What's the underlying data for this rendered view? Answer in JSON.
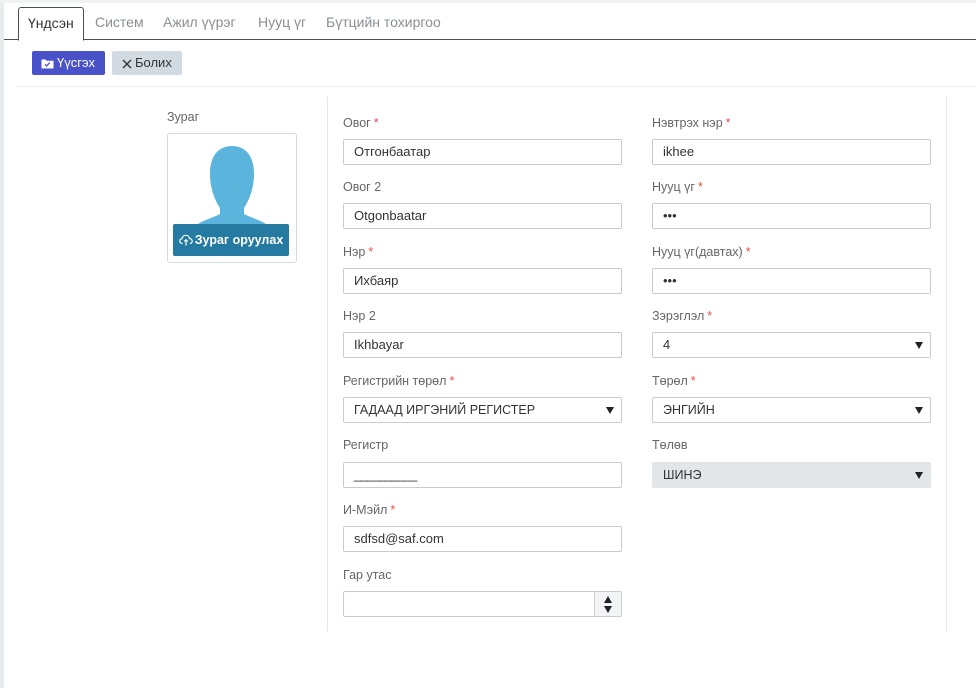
{
  "tabs": [
    {
      "label": "Үндсэн",
      "active": true
    },
    {
      "label": "Систем"
    },
    {
      "label": "Ажил үүрэг"
    },
    {
      "label": "Нууц үг"
    },
    {
      "label": "Бүтцийн тохиргоо"
    }
  ],
  "toolbar": {
    "save_label": "Үүсгэх",
    "save_icon": "folder-icon",
    "cancel_label": "Болих",
    "cancel_icon": "close-icon"
  },
  "photo": {
    "label": "Зураг",
    "upload_label": "Зураг оруулах",
    "upload_icon": "cloud-upload-icon"
  },
  "form": {
    "surname": {
      "label": "Овог",
      "required_mark": "*",
      "value": "Отгонбаатар"
    },
    "surname2": {
      "label": "Овог 2",
      "value": "Otgonbaatar"
    },
    "name": {
      "label": "Нэр",
      "required_mark": "*",
      "value": "Ихбаяр"
    },
    "name2": {
      "label": "Нэр 2",
      "value": "Ikhbayar"
    },
    "reg_type": {
      "label": "Регистрийн төрөл",
      "required_mark": "*",
      "value": "ГАДААД ИРГЭНИЙ РЕГИСТЕР"
    },
    "register": {
      "label": "Регистр",
      "value": "__________"
    },
    "email": {
      "label": "И-Мэйл",
      "required_mark": "*",
      "value": "sdfsd@saf.com"
    },
    "mobile": {
      "label": "Гар утас",
      "value": ""
    },
    "username": {
      "label": "Нэвтрэх нэр",
      "required_mark": "*",
      "value": "ikhee"
    },
    "password": {
      "label": "Нууц үг",
      "required_mark": "*",
      "value": "•••"
    },
    "password_repeat": {
      "label": "Нууц үг(давтах)",
      "required_mark": "*",
      "value": "•••"
    },
    "rank": {
      "label": "Зэрэглэл",
      "required_mark": "*",
      "value": "4"
    },
    "type": {
      "label": "Төрөл",
      "required_mark": "*",
      "value": "ЭНГИЙН"
    },
    "status": {
      "label": "Төлөв",
      "value": "ШИНЭ"
    }
  },
  "colors": {
    "primary_button": "#4a52c9",
    "upload_button": "#247aa0",
    "avatar": "#5ab4dc",
    "required": "#e5534b"
  }
}
